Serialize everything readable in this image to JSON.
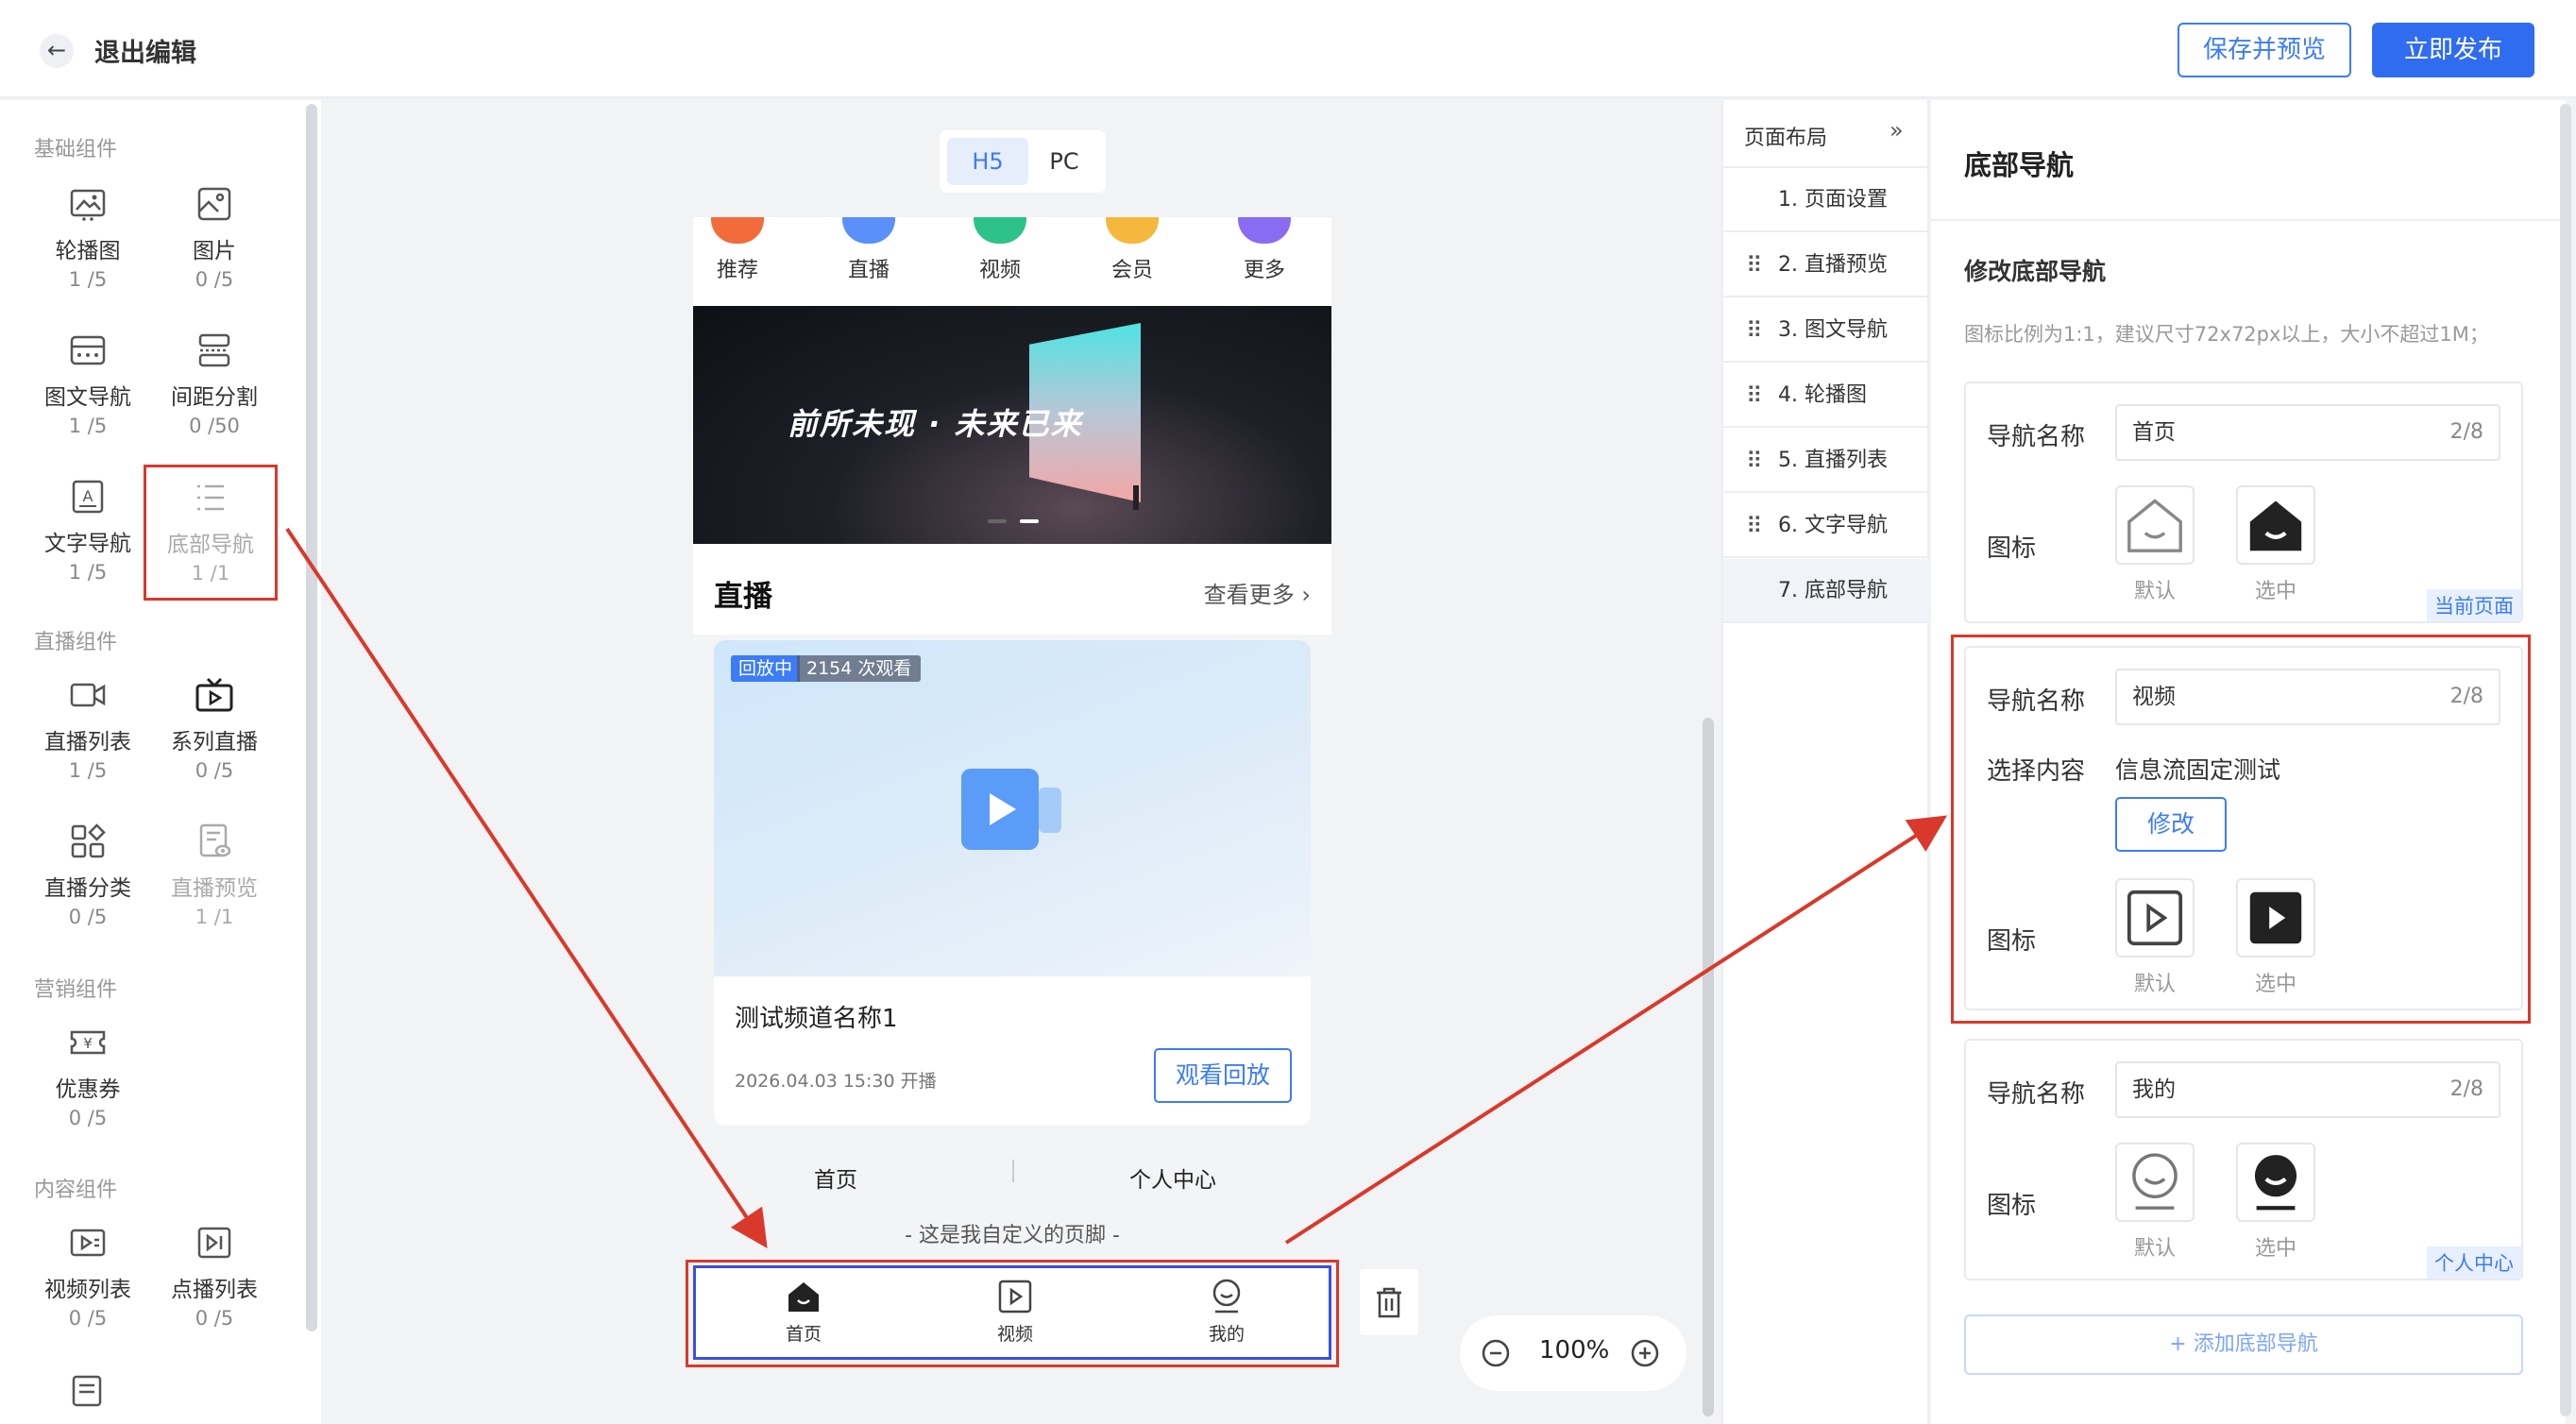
{
  "header": {
    "exit_label": "退出编辑",
    "preview_button": "保存并预览",
    "publish_button": "立即发布"
  },
  "left_panel": {
    "sections": [
      {
        "title": "基础组件"
      },
      {
        "title": "直播组件"
      },
      {
        "title": "营销组件"
      },
      {
        "title": "内容组件"
      }
    ],
    "items": [
      {
        "name": "轮播图",
        "count": "1 /5",
        "icon": "carousel-icon"
      },
      {
        "name": "图片",
        "count": "0 /5",
        "icon": "image-icon"
      },
      {
        "name": "图文导航",
        "count": "1 /5",
        "icon": "image-text-nav-icon"
      },
      {
        "name": "间距分割",
        "count": "0 /50",
        "icon": "spacer-icon"
      },
      {
        "name": "文字导航",
        "count": "1 /5",
        "icon": "text-nav-icon"
      },
      {
        "name": "底部导航",
        "count": "1 /1",
        "icon": "bottom-nav-icon"
      },
      {
        "name": "直播列表",
        "count": "1 /5",
        "icon": "live-list-icon"
      },
      {
        "name": "系列直播",
        "count": "0 /5",
        "icon": "series-live-icon"
      },
      {
        "name": "直播分类",
        "count": "0 /5",
        "icon": "live-category-icon"
      },
      {
        "name": "直播预览",
        "count": "1 /1",
        "icon": "live-preview-icon"
      },
      {
        "name": "优惠券",
        "count": "0 /5",
        "icon": "coupon-icon"
      },
      {
        "name": "视频列表",
        "count": "0 /5",
        "icon": "video-list-icon"
      },
      {
        "name": "点播列表",
        "count": "0 /5",
        "icon": "vod-list-icon"
      }
    ]
  },
  "canvas": {
    "tabs": [
      "H5",
      "PC"
    ],
    "categories": [
      {
        "label": "推荐",
        "color": "#f26b3a"
      },
      {
        "label": "直播",
        "color": "#5b8ff9"
      },
      {
        "label": "视频",
        "color": "#2ec28b"
      },
      {
        "label": "会员",
        "color": "#f5b83d"
      },
      {
        "label": "更多",
        "color": "#8a6cf2"
      }
    ],
    "banner_text": "前所未现 · 未来已来",
    "live_section_title": "直播",
    "more_link": "查看更多 ›",
    "card": {
      "status": "回放中",
      "views": "2154 次观看",
      "title": "测试频道名称1",
      "time": "2026.04.03 15:30 开播",
      "button": "观看回放"
    },
    "text_nav": [
      "首页",
      "个人中心"
    ],
    "footer_text": "- 这是我自定义的页脚 -",
    "bottom_nav": [
      "首页",
      "视频",
      "我的"
    ],
    "zoom": "100%"
  },
  "layout_panel": {
    "title": "页面布局",
    "items": [
      "1. 页面设置",
      "2. 直播预览",
      "3. 图文导航",
      "4. 轮播图",
      "5. 直播列表",
      "6. 文字导航",
      "7. 底部导航"
    ]
  },
  "settings": {
    "title": "底部导航",
    "subtitle": "修改底部导航",
    "hint": "图标比例为1:1，建议尺寸72x72px以上，大小不超过1M；",
    "name_label": "导航名称",
    "icon_label": "图标",
    "content_label": "选择内容",
    "default_label": "默认",
    "selected_label": "选中",
    "navs": [
      {
        "name": "首页",
        "count": "2/8",
        "tag": "当前页面"
      },
      {
        "name": "视频",
        "count": "2/8",
        "content": "信息流固定测试",
        "modify": "修改"
      },
      {
        "name": "我的",
        "count": "2/8",
        "tag": "个人中心"
      }
    ],
    "add_button": "+ 添加底部导航"
  },
  "colors": {
    "primary": "#2f6cf0",
    "highlight": "#d9392b"
  }
}
